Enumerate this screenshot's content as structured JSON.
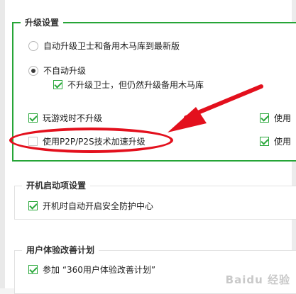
{
  "upgrade": {
    "title": "升级设置",
    "opt_auto": "自动升级卫士和备用木马库到最新版",
    "opt_no_auto": "不自动升级",
    "opt_no_guard": "不升级卫士，但仍然升级备用木马库",
    "opt_game": "玩游戏时不升级",
    "opt_right1": "使用",
    "opt_p2p": "使用P2P/P2S技术加速升级",
    "opt_right2": "使用"
  },
  "startup": {
    "title": "开机启动项设置",
    "opt_autostart": "开机时自动开启安全防护中心"
  },
  "ux": {
    "title": "用户体验改善计划",
    "opt_join": "参加 “360用户体验改善计划”"
  },
  "colors": {
    "accent": "#26a537",
    "annotation": "#e3101d"
  },
  "watermark": "Baidu 经验"
}
